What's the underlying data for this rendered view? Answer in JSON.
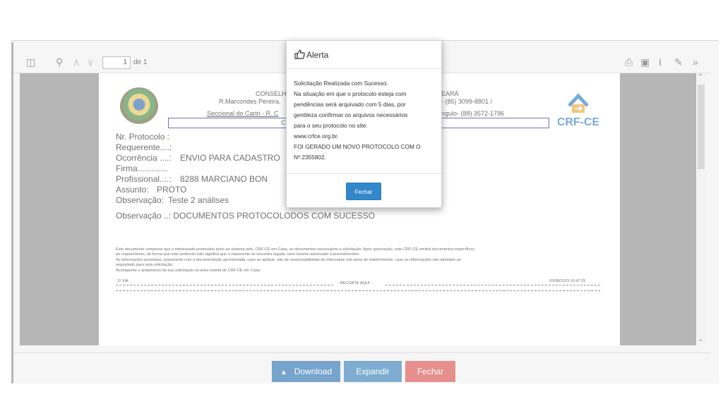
{
  "toolbar": {
    "page_number": "1",
    "page_of": "de 1"
  },
  "document": {
    "header_line1": "CONSELH",
    "header_line1_right": "EARÁ",
    "header_line2": "R.Marcondes Pereira,",
    "header_line2_right": "- (85) 3099-8801 /",
    "header_line3": "Seccional do Cariri - R. C",
    "header_line3_right": "ngulo- (88) 3572-1796",
    "header_c": "C",
    "logo_text": "CRF-CE",
    "fields": [
      {
        "label": "Nr. Protocolo :",
        "value": ""
      },
      {
        "label": "Requerente....:",
        "value": ""
      },
      {
        "label": "Ocorrência ....:",
        "value": "ENVIO PARA CADASTRO"
      },
      {
        "label": "Firma.............",
        "value": ""
      },
      {
        "label": "Profissional....:",
        "value": "8288     MARCIANO BON"
      },
      {
        "label": "Assunto:",
        "value": "PROTO"
      },
      {
        "label": "Observação:",
        "value": "Teste 2 análises"
      }
    ],
    "observacao2": "Observação ..: DOCUMENTOS PROTOCOLODOS COM SUCESSO",
    "footer_lines": [
      "Este documento comprova que o interessado protocolou junto ao sistema web, CRF-CE em Casa, os documentos necessários a solicitação. Após apreciação, este CRF-CE emitirá documentos específicos",
      "ao requerimento, de forma que este protocolo não significa que o requerente se encontra regular, nem mesmo autorizado a procedimentos.",
      "As informações prestadas, juntamente com a documentação apresentada, caso se aplique, são de responsabilidade do informante sob pena de indeferimento, caso as informações não atendam ao",
      "requisitado para esta solicitação.",
      "Acompanhe o andamento da sua solicitação na área restrita do CRF-CE em Casa."
    ],
    "via": "1ª VIA",
    "recorte": "- RECORTE AQUI -",
    "timestamp": "03/08/2023 10:47:25"
  },
  "buttons": {
    "download": "Download",
    "expandir": "Expandir",
    "fechar": "Fechar"
  },
  "alert": {
    "title": "Alerta",
    "lines": [
      "Solicitação Realizada com Sucesso.",
      "Na situação em que o protocolo esteja com",
      "pendências será arquivado com 5 dias, por",
      "gentileza confirmar os arquivos necessários",
      "para o seu protocolo no site:",
      "www.crfce.org.br.",
      "FOI GERADO UM NOVO PROTOCOLO COM O",
      "Nº:2355802."
    ],
    "button": "Fechar"
  },
  "colors": {
    "download": "#2f73b0",
    "expandir": "#3a82b9",
    "fechar": "#d9534f",
    "modal_button": "#3388c9"
  }
}
